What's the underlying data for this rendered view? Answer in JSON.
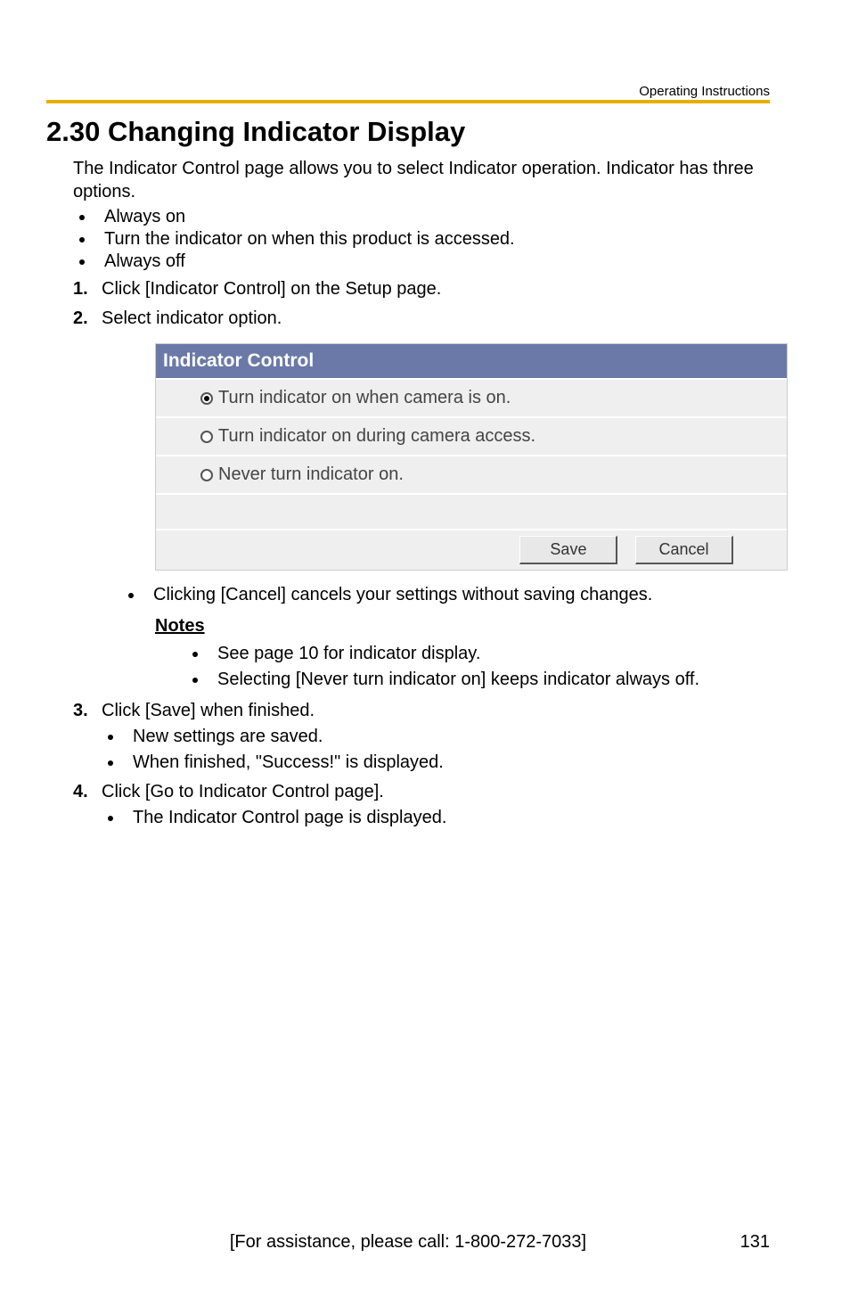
{
  "header": {
    "running_head": "Operating Instructions"
  },
  "title": "2.30  Changing Indicator Display",
  "intro": "The Indicator Control page allows you to select Indicator operation. Indicator has three options.",
  "options_list": [
    "Always on",
    "Turn the indicator on when this product is accessed.",
    "Always off"
  ],
  "steps": {
    "s1": {
      "num": "1.",
      "text": "Click [Indicator Control] on the Setup page."
    },
    "s2": {
      "num": "2.",
      "text": "Select indicator option."
    },
    "s3": {
      "num": "3.",
      "text": "Click [Save] when finished."
    },
    "s4": {
      "num": "4.",
      "text": "Click [Go to Indicator Control page]."
    }
  },
  "panel": {
    "title": "Indicator Control",
    "opts": [
      {
        "label": "Turn indicator on when camera is on.",
        "selected": true
      },
      {
        "label": "Turn indicator on during camera access.",
        "selected": false
      },
      {
        "label": "Never turn indicator on.",
        "selected": false
      }
    ],
    "buttons": {
      "save": "Save",
      "cancel": "Cancel"
    }
  },
  "after_panel_bullet": "Clicking [Cancel] cancels your settings without saving changes.",
  "notes": {
    "heading": "Notes",
    "items": [
      "See page 10 for indicator display.",
      "Selecting [Never turn indicator on] keeps indicator always off."
    ]
  },
  "step3_sub": [
    "New settings are saved.",
    "When finished, \"Success!\" is displayed."
  ],
  "step4_sub": [
    "The Indicator Control page is displayed."
  ],
  "footer": {
    "assist": "[For assistance, please call: 1-800-272-7033]",
    "page": "131"
  }
}
